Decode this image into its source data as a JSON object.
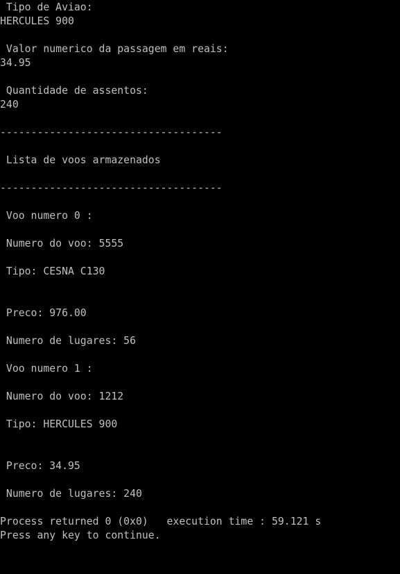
{
  "console": {
    "lines": [
      " Tipo de Aviao:",
      "HERCULES 900",
      "",
      " Valor numerico da passagem em reais:",
      "34.95",
      "",
      " Quantidade de assentos:",
      "240",
      "",
      "------------------------------------",
      "",
      " Lista de voos armazenados",
      "",
      "------------------------------------",
      "",
      " Voo numero 0 :",
      "",
      " Numero do voo: 5555",
      "",
      " Tipo: CESNA C130",
      "",
      "",
      " Preco: 976.00",
      "",
      " Numero de lugares: 56",
      "",
      " Voo numero 1 :",
      "",
      " Numero do voo: 1212",
      "",
      " Tipo: HERCULES 900",
      "",
      "",
      " Preco: 34.95",
      "",
      " Numero de lugares: 240",
      "",
      "Process returned 0 (0x0)   execution time : 59.121 s",
      "Press any key to continue."
    ]
  },
  "colors": {
    "background": "#000000",
    "text": "#c0c0c0"
  }
}
